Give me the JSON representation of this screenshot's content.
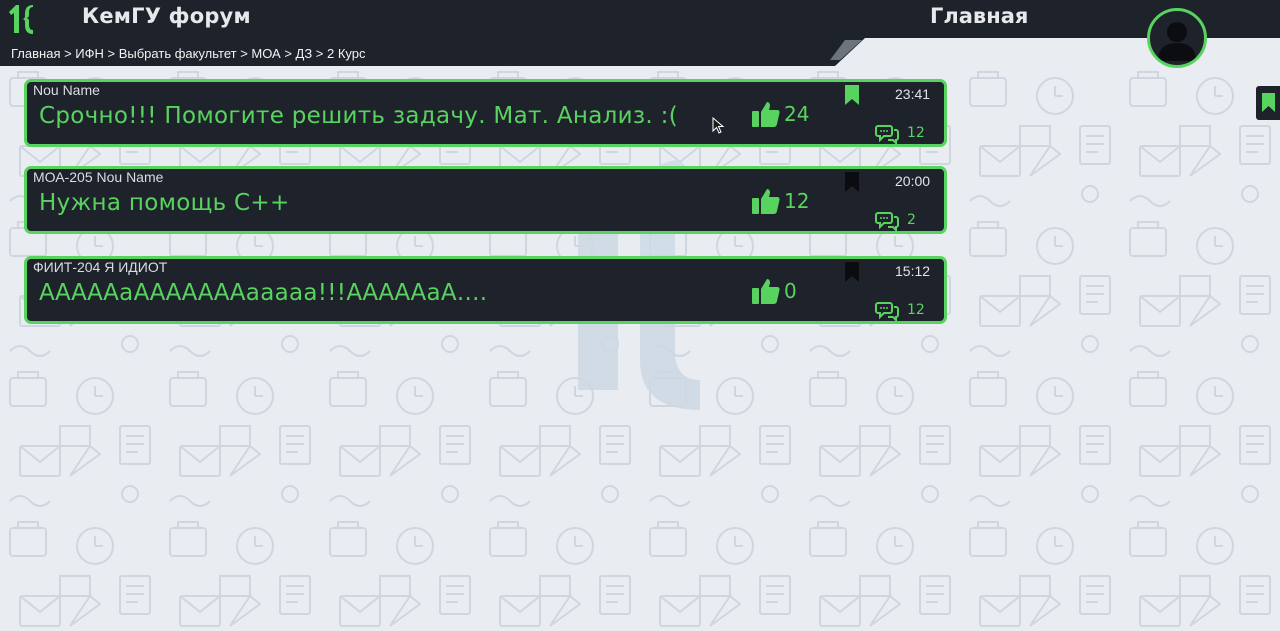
{
  "header": {
    "site_title": "КемГУ форум",
    "page_heading": "Главная",
    "logo_icon": "logo-1k-icon",
    "avatar_icon": "user-avatar-icon"
  },
  "breadcrumb": "Главная > ИФН > Выбрать факультет > МОА > ДЗ > 2 Курс",
  "colors": {
    "accent": "#59d35f",
    "dark": "#1e232b",
    "background": "#e9edf2"
  },
  "posts": [
    {
      "meta": "Nou Name",
      "title": "Срочно!!! Помогите решить задачу. Мат. Анализ. :(",
      "likes": "24",
      "time": "23:41",
      "comments": "12",
      "bookmarked": true
    },
    {
      "meta": "МОА-205 Nou Name",
      "title": "Нужна помощь  C++",
      "likes": "12",
      "time": "20:00",
      "comments": "2",
      "bookmarked": false
    },
    {
      "meta": "ФИИТ-204 Я ИДИОТ",
      "title": "АААААаАААААААааааа!!!АААААаА....",
      "likes": "0",
      "time": "15:12",
      "comments": "12",
      "bookmarked": false
    }
  ]
}
